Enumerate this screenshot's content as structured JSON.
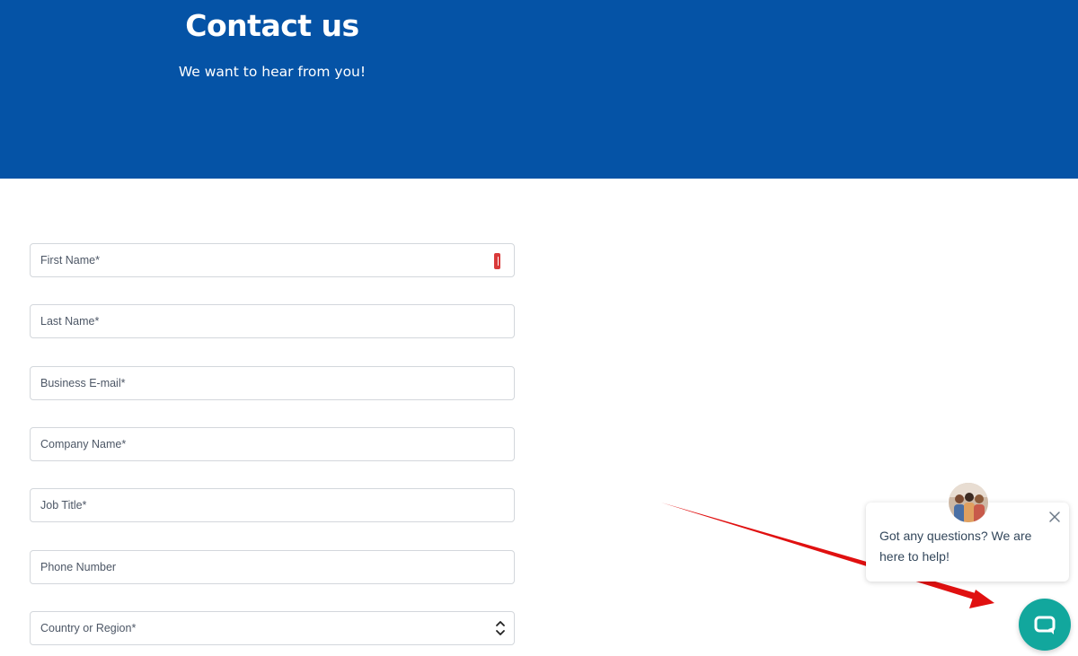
{
  "hero": {
    "title": "Contact us",
    "subtitle": "We want to hear from you!",
    "background_color": "#0553a6"
  },
  "form": {
    "fields": [
      {
        "placeholder": "First Name*",
        "value": ""
      },
      {
        "placeholder": "Last Name*",
        "value": ""
      },
      {
        "placeholder": "Business E-mail*",
        "value": ""
      },
      {
        "placeholder": "Company Name*",
        "value": ""
      },
      {
        "placeholder": "Job Title*",
        "value": ""
      },
      {
        "placeholder": "Phone Number",
        "value": ""
      }
    ],
    "country_select": {
      "selected": "Country or Region*"
    }
  },
  "chat": {
    "message": "Got any questions? We are here to help!",
    "accent_color": "#12a79d",
    "icons": {
      "close": "close-icon",
      "launcher": "chat-bubble-icon",
      "avatar": "agent-avatar"
    }
  },
  "annotation": {
    "arrow_color": "#e01010"
  }
}
